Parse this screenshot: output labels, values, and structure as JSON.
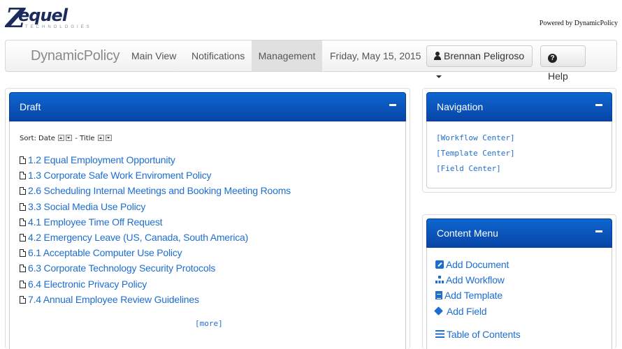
{
  "header": {
    "logo_text": "ZEQUEL",
    "logo_subtext": "TECHNOLOGIES",
    "powered_by": "Powered by DynamicPolicy"
  },
  "navbar": {
    "app_name": "DynamicPolicy",
    "items": [
      {
        "label": "Main View",
        "active": false
      },
      {
        "label": "Notifications",
        "active": false
      },
      {
        "label": "Management",
        "active": true
      }
    ],
    "date": "Friday, May 15, 2015",
    "user_name": "Brennan Peligroso",
    "help_label": "Help",
    "icons": {
      "user": "user-icon",
      "help": "question-circle-icon"
    }
  },
  "draft": {
    "title": "Draft",
    "sort": {
      "prefix": "Sort: Date",
      "separator": "- Title"
    },
    "documents": [
      "1.2 Equal Employment Opportunity",
      "1.3 Corporate Safe Work Enviroment Policy",
      "2.6 Scheduling Internal Meetings and Booking Meeting Rooms",
      "3.3 Social Media Use Policy",
      "4.1 Employee Time Off Request",
      "4.2 Emergency Leave (US, Canada, South America)",
      "6.1 Acceptable Computer Use Policy",
      "6.3 Corporate Technology Security Protocols",
      "6.4 Electronic Privacy Policy",
      "7.4 Annual Employee Review Guidelines"
    ],
    "more_label": "[more]"
  },
  "navigation": {
    "title": "Navigation",
    "links": [
      "[Workflow Center]",
      "[Template Center]",
      "[Field Center]"
    ]
  },
  "content_menu": {
    "title": "Content Menu",
    "items": [
      {
        "label": "Add Document",
        "icon": "edit-icon"
      },
      {
        "label": "Add Workflow",
        "icon": "sitemap-icon"
      },
      {
        "label": "Add Template",
        "icon": "file-text-icon"
      },
      {
        "label": "Add Field",
        "icon": "tag-icon"
      }
    ],
    "toc_label": "Table of Contents",
    "toc_icon": "list-icon"
  },
  "colors": {
    "panel_header": "#0d66d0",
    "link": "#1e6ed0"
  }
}
